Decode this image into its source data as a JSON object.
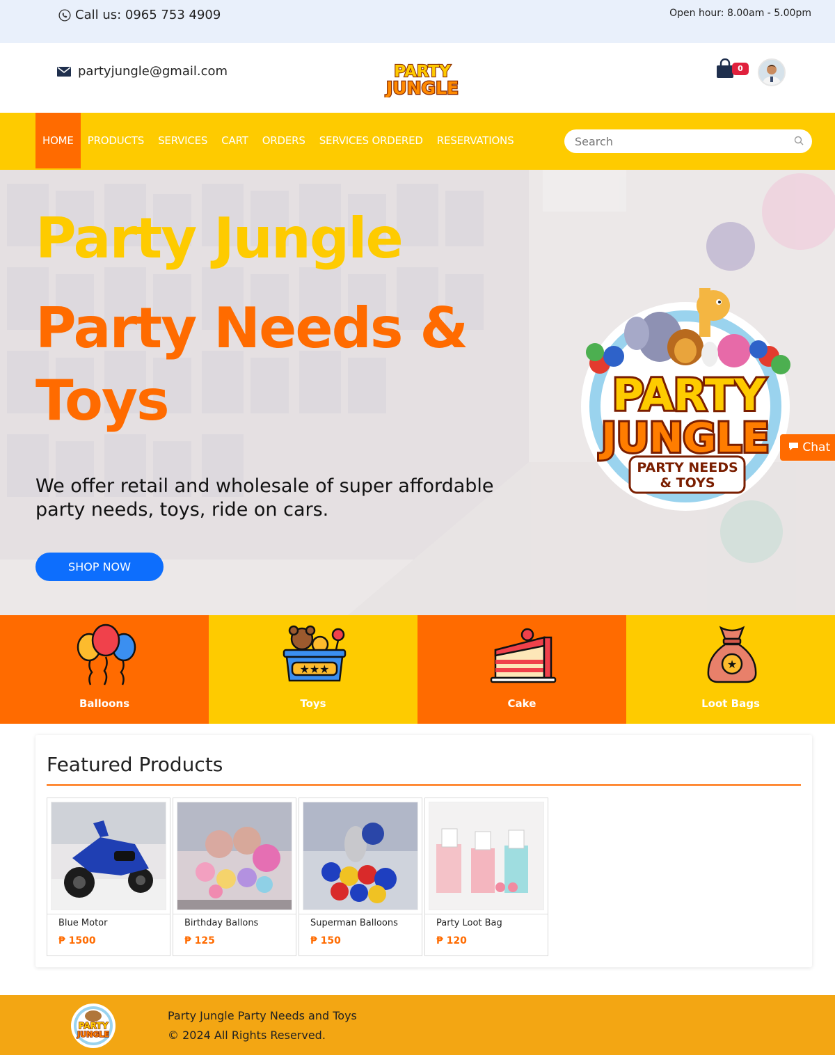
{
  "topbar": {
    "phone_icon": "phone-icon",
    "call_text": "Call us: 0965 753 4909",
    "hours_text": "Open hour: 8.00am - 5.00pm"
  },
  "header": {
    "email_icon": "envelope-icon",
    "email": "partyjungle@gmail.com",
    "logo_text": "PARTY JUNGLE",
    "cart_icon": "shopping-bag-icon",
    "cart_count": "0"
  },
  "nav": {
    "items": [
      "HOME",
      "PRODUCTS",
      "SERVICES",
      "CART",
      "ORDERS",
      "SERVICES ORDERED",
      "RESERVATIONS"
    ],
    "active_index": 0,
    "search_placeholder": "Search"
  },
  "hero": {
    "title_line1": "Party Jungle",
    "title_line2": "Party Needs & Toys",
    "description": "We offer retail and wholesale of super affordable party needs, toys, ride on cars.",
    "cta": "SHOP NOW",
    "logo_line1": "PARTY",
    "logo_line2": "JUNGLE",
    "logo_line3": "PARTY NEEDS",
    "logo_line4": "& TOYS"
  },
  "chat": {
    "label": "Chat",
    "icon": "chat-bubble-icon"
  },
  "categories": [
    {
      "label": "Balloons",
      "icon": "balloons-icon"
    },
    {
      "label": "Toys",
      "icon": "toy-box-icon"
    },
    {
      "label": "Cake",
      "icon": "cake-slice-icon"
    },
    {
      "label": "Loot Bags",
      "icon": "loot-bag-icon"
    }
  ],
  "featured": {
    "title": "Featured Products",
    "products": [
      {
        "name": "Blue Motor",
        "price": "₱ 1500"
      },
      {
        "name": "Birthday Ballons",
        "price": "₱ 125"
      },
      {
        "name": "Superman Balloons",
        "price": "₱ 150"
      },
      {
        "name": "Party Loot Bag",
        "price": "₱ 120"
      }
    ]
  },
  "footer": {
    "line1": "Party Jungle Party Needs and Toys",
    "line2": "© 2024 All Rights Reserved."
  },
  "colors": {
    "yellow": "#fecb00",
    "orange": "#ff6b00",
    "blue_button": "#0d6efd",
    "footer": "#f3a613",
    "topbar": "#e9f0fb"
  }
}
